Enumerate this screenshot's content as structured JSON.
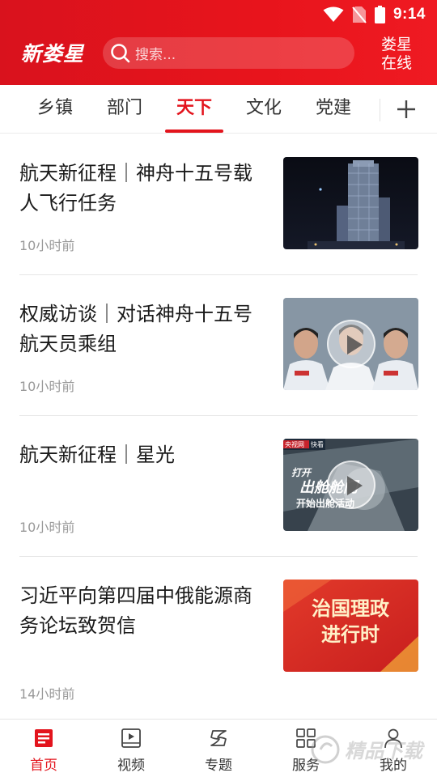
{
  "status_bar": {
    "time": "9:14"
  },
  "header": {
    "logo_text": "新娄星",
    "search_placeholder": "搜索...",
    "site_name_line1": "娄星",
    "site_name_line2": "在线",
    "colors": {
      "brand_red": "#e3141d"
    }
  },
  "tabs": [
    {
      "label": "乡镇",
      "active": false
    },
    {
      "label": "部门",
      "active": false
    },
    {
      "label": "天下",
      "active": true
    },
    {
      "label": "文化",
      "active": false
    },
    {
      "label": "党建",
      "active": false
    }
  ],
  "tab_add_icon": "plus-icon",
  "news": [
    {
      "title": "航天新征程｜神舟十五号载人飞行任务",
      "time": "10小时前",
      "thumb": "rocket-launch-tower-night",
      "video": false
    },
    {
      "title": "权威访谈｜对话神舟十五号航天员乘组",
      "time": "10小时前",
      "thumb": "three-astronauts-portrait",
      "video": true
    },
    {
      "title": "航天新征程｜星光",
      "time": "10小时前",
      "thumb": "spacewalk-video-frame",
      "video": true,
      "thumb_text": {
        "badge": "央视网",
        "badge2": "快看",
        "line1": "打开",
        "line2": "出舱舱门",
        "line3": "开始出舱活动"
      }
    },
    {
      "title": "习近平向第四届中俄能源商务论坛致贺信",
      "time": "14小时前",
      "thumb": "red-banner",
      "video": false,
      "thumb_text": {
        "line1": "治国理政",
        "line2": "进行时"
      }
    }
  ],
  "bottom_nav": [
    {
      "label": "首页",
      "icon": "home-news-icon",
      "active": true
    },
    {
      "label": "视频",
      "icon": "video-icon",
      "active": false
    },
    {
      "label": "专题",
      "icon": "topic-icon",
      "active": false
    },
    {
      "label": "服务",
      "icon": "grid-icon",
      "active": false
    },
    {
      "label": "我的",
      "icon": "user-icon",
      "active": false
    }
  ],
  "watermark_text": "精品下载"
}
